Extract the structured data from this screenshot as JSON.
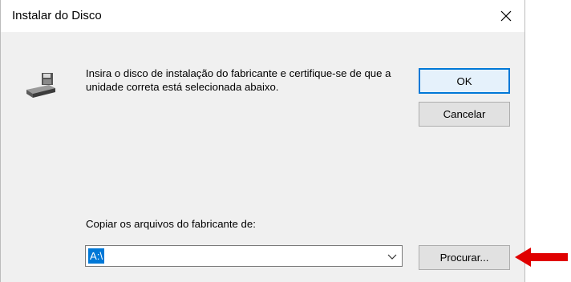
{
  "window": {
    "title": "Instalar do Disco",
    "close_glyph": "✕"
  },
  "message": "Insira o disco de instalação do fabricante e certifique-se de que a unidade correta está selecionada abaixo.",
  "buttons": {
    "ok": "OK",
    "cancel": "Cancelar",
    "browse": "Procurar..."
  },
  "copy_from": {
    "label": "Copiar os arquivos do fabricante de:",
    "value": "A:\\"
  },
  "icons": {
    "disk": "disk-drive-icon",
    "dropdown": "chevron-down-icon",
    "annotation": "red-arrow-icon"
  },
  "colors": {
    "dialog_bg": "#f0f0f0",
    "accent": "#0078d7",
    "annotation_arrow": "#e00000"
  }
}
